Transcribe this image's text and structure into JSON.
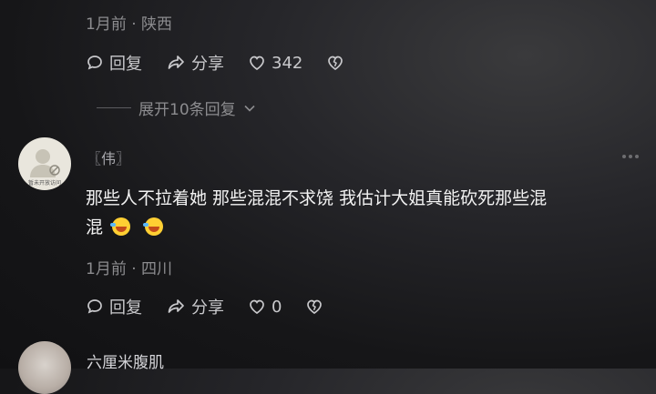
{
  "comment_prev": {
    "meta": "1月前 · 陕西",
    "actions": {
      "reply": "回复",
      "share": "分享",
      "likes": "342"
    },
    "expand": "展开10条回复"
  },
  "comment_main": {
    "avatar_caption": "暂未开放访问",
    "username": "〖伟〗",
    "text_line1": "那些人不拉着她 那些混混不求饶 我估计大姐真能砍死那些混",
    "text_line2": "混",
    "meta": "1月前 · 四川",
    "actions": {
      "reply": "回复",
      "share": "分享",
      "likes": "0"
    }
  },
  "comment_next": {
    "username": "六厘米腹肌"
  },
  "icons": {
    "reply": "speech-bubble-icon",
    "share": "share-arrow-icon",
    "like": "heart-icon",
    "dislike": "broken-heart-icon",
    "more": "more-dots-icon",
    "chevron": "chevron-down-icon",
    "emoji": "laughing-crying-emoji-icon",
    "avatar_placeholder": "default-user-icon"
  }
}
